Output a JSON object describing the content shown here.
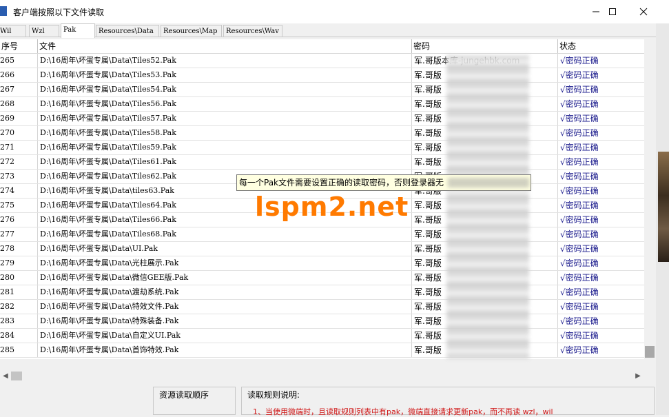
{
  "window": {
    "title": "客户端按照以下文件读取"
  },
  "tabs": [
    {
      "label": "Wil"
    },
    {
      "label": "Wzl"
    },
    {
      "label": "Pak"
    },
    {
      "label": "Resources\\Data"
    },
    {
      "label": "Resources\\Map"
    },
    {
      "label": "Resources\\Wav"
    }
  ],
  "table": {
    "headers": {
      "index": "序号",
      "file": "文件",
      "password": "密码",
      "status": "状态"
    },
    "rows": [
      {
        "index": "265",
        "file": "D:\\16周年\\坏蛋专属\\Data\\Tiles52.Pak",
        "password": "军.哥版本库-jungehbk.com",
        "status": "√密码正确"
      },
      {
        "index": "266",
        "file": "D:\\16周年\\坏蛋专属\\Data\\Tiles53.Pak",
        "password": "军.哥版",
        "status": "√密码正确"
      },
      {
        "index": "267",
        "file": "D:\\16周年\\坏蛋专属\\Data\\Tiles54.Pak",
        "password": "军.哥版",
        "status": "√密码正确"
      },
      {
        "index": "268",
        "file": "D:\\16周年\\坏蛋专属\\Data\\Tiles56.Pak",
        "password": "军.哥版",
        "status": "√密码正确"
      },
      {
        "index": "269",
        "file": "D:\\16周年\\坏蛋专属\\Data\\Tiles57.Pak",
        "password": "军.哥版",
        "status": "√密码正确"
      },
      {
        "index": "270",
        "file": "D:\\16周年\\坏蛋专属\\Data\\Tiles58.Pak",
        "password": "军.哥版",
        "status": "√密码正确"
      },
      {
        "index": "271",
        "file": "D:\\16周年\\坏蛋专属\\Data\\Tiles59.Pak",
        "password": "军.哥版",
        "status": "√密码正确"
      },
      {
        "index": "272",
        "file": "D:\\16周年\\坏蛋专属\\Data\\Tiles61.Pak",
        "password": "军.哥版",
        "status": "√密码正确"
      },
      {
        "index": "273",
        "file": "D:\\16周年\\坏蛋专属\\Data\\Tiles62.Pak",
        "password": "军.哥版",
        "status": "√密码正确"
      },
      {
        "index": "274",
        "file": "D:\\16周年\\坏蛋专属\\Data\\tiles63.Pak",
        "password": "军.哥版",
        "status": "√密码正确"
      },
      {
        "index": "275",
        "file": "D:\\16周年\\坏蛋专属\\Data\\Tiles64.Pak",
        "password": "军.哥版",
        "status": "√密码正确"
      },
      {
        "index": "276",
        "file": "D:\\16周年\\坏蛋专属\\Data\\Tiles66.Pak",
        "password": "军.哥版",
        "status": "√密码正确"
      },
      {
        "index": "277",
        "file": "D:\\16周年\\坏蛋专属\\Data\\Tiles68.Pak",
        "password": "军.哥版",
        "status": "√密码正确"
      },
      {
        "index": "278",
        "file": "D:\\16周年\\坏蛋专属\\Data\\UI.Pak",
        "password": "军.哥版",
        "status": "√密码正确"
      },
      {
        "index": "279",
        "file": "D:\\16周年\\坏蛋专属\\Data\\光柱展示.Pak",
        "password": "军.哥版",
        "status": "√密码正确"
      },
      {
        "index": "280",
        "file": "D:\\16周年\\坏蛋专属\\Data\\微信GEE版.Pak",
        "password": "军.哥版",
        "status": "√密码正确"
      },
      {
        "index": "281",
        "file": "D:\\16周年\\坏蛋专属\\Data\\渡劫系统.Pak",
        "password": "军.哥版",
        "status": "√密码正确"
      },
      {
        "index": "282",
        "file": "D:\\16周年\\坏蛋专属\\Data\\特效文件.Pak",
        "password": "军.哥版",
        "status": "√密码正确"
      },
      {
        "index": "283",
        "file": "D:\\16周年\\坏蛋专属\\Data\\特殊装备.Pak",
        "password": "军.哥版",
        "status": "√密码正确"
      },
      {
        "index": "284",
        "file": "D:\\16周年\\坏蛋专属\\Data\\自定义UI.Pak",
        "password": "军.哥版",
        "status": "√密码正确"
      },
      {
        "index": "285",
        "file": "D:\\16周年\\坏蛋专属\\Data\\首饰特效.Pak",
        "password": "军.哥版",
        "status": "√密码正确"
      }
    ]
  },
  "tooltip": {
    "text": "每一个Pak文件需要设置正确的读取密码，否则登录器无"
  },
  "watermark": {
    "text": "lspm2.net"
  },
  "panels": {
    "order_title": "资源读取顺序",
    "rules_title": "读取规则说明:",
    "rule_1": "1、当使用微端时，且读取规则列表中有pak，微端直接请求更新pak，而不再读 wzl，wil"
  },
  "colors": {
    "status_text": "#1a1a8c",
    "rule_text": "#d01818",
    "watermark": "#ff7a00",
    "tooltip_bg": "#ffffe1"
  },
  "icons": [
    "app-icon",
    "minimize-icon",
    "maximize-icon",
    "close-icon",
    "scroll-left-icon",
    "scroll-right-icon"
  ]
}
